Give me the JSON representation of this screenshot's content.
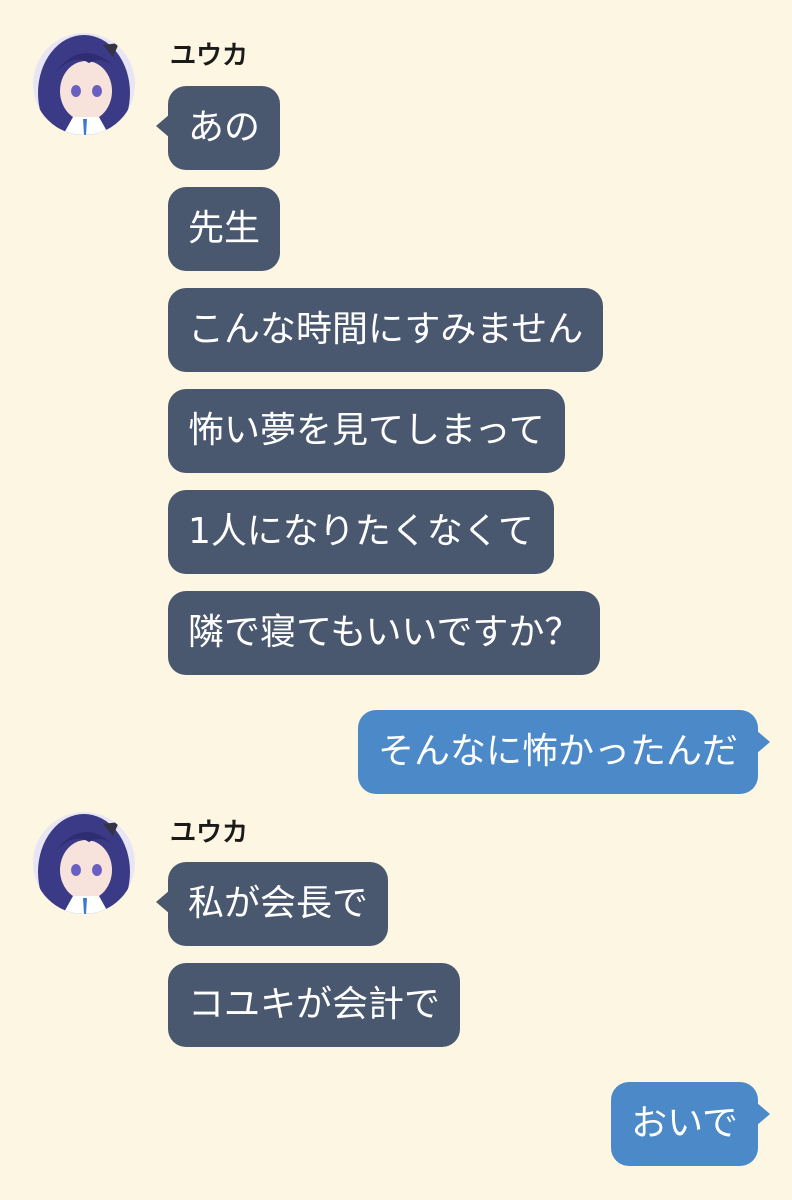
{
  "chat": {
    "groups": [
      {
        "sender": "ユウカ",
        "avatar_icon": "character-avatar-icon",
        "messages": [
          "あの",
          "先生",
          "こんな時間にすみません",
          "怖い夢を見てしまって",
          "1人になりたくなくて",
          "隣で寝てもいいですか？"
        ]
      },
      {
        "outgoing": [
          "そんなに怖かったんだ"
        ]
      },
      {
        "sender": "ユウカ",
        "avatar_icon": "character-avatar-icon",
        "messages": [
          "私が会長で",
          "コユキが会計で"
        ]
      },
      {
        "outgoing": [
          "おいで"
        ]
      }
    ]
  },
  "colors": {
    "background": "#fdf6e2",
    "incoming_bubble": "#4a586f",
    "outgoing_bubble": "#4c89c8",
    "avatar_hair": "#3b3a86"
  }
}
